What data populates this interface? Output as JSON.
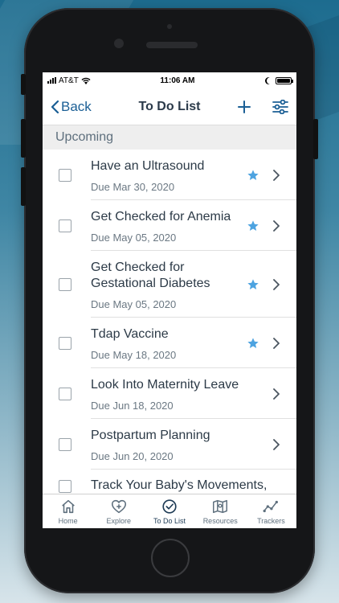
{
  "statusbar": {
    "carrier": "AT&T",
    "time": "11:06 AM",
    "battery_level": 1.0
  },
  "navbar": {
    "back_label": "Back",
    "title": "To Do List"
  },
  "icons": {
    "back": "chevron-left-icon",
    "add": "plus-icon",
    "filter": "sliders-icon",
    "star": "star-icon",
    "chevron": "chevron-right-icon"
  },
  "colors": {
    "accent": "#1b5f95",
    "star": "#4da3e0",
    "text": "#2c3a47",
    "muted": "#6b7883",
    "section_bg": "#eeeeee"
  },
  "section": {
    "label": "Upcoming"
  },
  "items": [
    {
      "title": "Have an Ultrasound",
      "due": "Due Mar 30, 2020",
      "starred": true
    },
    {
      "title": "Get Checked for Anemia",
      "due": "Due May 05, 2020",
      "starred": true
    },
    {
      "title": "Get Checked for\nGestational Diabetes",
      "due": "Due May 05, 2020",
      "starred": true
    },
    {
      "title": "Tdap Vaccine",
      "due": "Due May 18, 2020",
      "starred": true
    },
    {
      "title": "Look Into Maternity Leave",
      "due": "Due Jun 18, 2020",
      "starred": false
    },
    {
      "title": "Postpartum Planning",
      "due": "Due Jun 20, 2020",
      "starred": false
    },
    {
      "title": "Track Your Baby's Movements,",
      "due": "",
      "starred": false
    }
  ],
  "tabs": [
    {
      "label": "Home",
      "icon": "home-icon",
      "active": false
    },
    {
      "label": "Explore",
      "icon": "heart-plus-icon",
      "active": false
    },
    {
      "label": "To Do List",
      "icon": "check-circle-icon",
      "active": true
    },
    {
      "label": "Resources",
      "icon": "map-icon",
      "active": false
    },
    {
      "label": "Trackers",
      "icon": "chart-line-icon",
      "active": false
    }
  ]
}
